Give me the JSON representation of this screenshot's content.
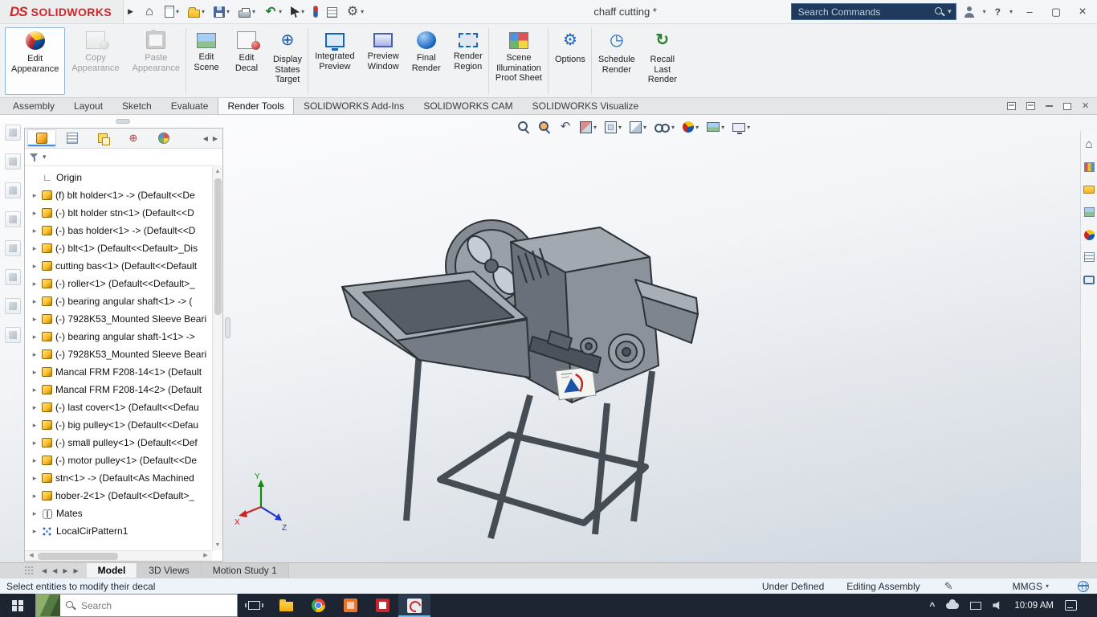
{
  "colors": {
    "brand_red": "#d1242b",
    "accent_blue": "#1565c0",
    "taskbar_bg": "#1c2531",
    "status_bg": "#eef3f9",
    "viewport_bottom": "#cfd6de"
  },
  "titlebar": {
    "logo_ds": "DS",
    "logo_brand": "SOLIDWORKS",
    "doc_title": "chaff cutting *",
    "search_placeholder": "Search Commands",
    "help_label": "?",
    "window": {
      "minimize": "–",
      "maximize": "▢",
      "close": "×"
    },
    "quick_tools": [
      {
        "icon": "home-icon"
      },
      {
        "icon": "new-document-icon",
        "caret": true
      },
      {
        "icon": "open-icon",
        "caret": true
      },
      {
        "icon": "save-icon",
        "caret": true
      },
      {
        "icon": "print-icon",
        "caret": true
      },
      {
        "icon": "undo-icon",
        "caret": true
      },
      {
        "icon": "select-cursor-icon",
        "caret": true
      },
      {
        "icon": "marker-icon"
      },
      {
        "icon": "evaluate-icon"
      },
      {
        "icon": "options-gear-icon",
        "caret": true
      }
    ]
  },
  "ribbon": {
    "buttons": [
      {
        "label": "Edit\nAppearance",
        "icon": "edit-appearance-icon",
        "state": "selected"
      },
      {
        "label": "Copy\nAppearance",
        "icon": "copy-appearance-icon",
        "state": "disabled"
      },
      {
        "label": "Paste\nAppearance",
        "icon": "paste-appearance-icon",
        "state": "disabled gsep"
      },
      {
        "label": "Edit\nScene",
        "icon": "edit-scene-icon"
      },
      {
        "label": "Edit\nDecal",
        "icon": "edit-decal-icon"
      },
      {
        "label": "Display\nStates\nTarget",
        "icon": "display-states-target-icon",
        "glyph": "⊕",
        "state": "gsep"
      },
      {
        "label": "Integrated\nPreview",
        "icon": "integrated-preview-icon"
      },
      {
        "label": "Preview\nWindow",
        "icon": "preview-window-icon"
      },
      {
        "label": "Final\nRender",
        "icon": "final-render-icon"
      },
      {
        "label": "Render\nRegion",
        "icon": "render-region-icon",
        "state": "gsep"
      },
      {
        "label": "Scene\nIllumination\nProof Sheet",
        "icon": "scene-illumination-icon",
        "state": "gsep"
      },
      {
        "label": "Options",
        "icon": "render-options-icon",
        "glyph": "⚙",
        "state": "gsep"
      },
      {
        "label": "Schedule\nRender",
        "icon": "schedule-render-icon",
        "glyph": "◷"
      },
      {
        "label": "Recall\nLast\nRender",
        "icon": "recall-last-render-icon",
        "glyph": "↻"
      }
    ]
  },
  "command_tabs": [
    {
      "label": "Assembly"
    },
    {
      "label": "Layout"
    },
    {
      "label": "Sketch"
    },
    {
      "label": "Evaluate"
    },
    {
      "label": "Render Tools",
      "state": "active"
    },
    {
      "label": "SOLIDWORKS Add-Ins"
    },
    {
      "label": "SOLIDWORKS CAM"
    },
    {
      "label": "SOLIDWORKS Visualize"
    }
  ],
  "fm_panel": {
    "tabs": [
      {
        "icon": "featuremanager-tab-icon",
        "state": "active"
      },
      {
        "icon": "propertymanager-tab-icon"
      },
      {
        "icon": "configurationmanager-tab-icon"
      },
      {
        "icon": "dimxpert-tab-icon",
        "glyph": "⊕"
      },
      {
        "icon": "displaymanager-tab-icon"
      }
    ],
    "tree_items": [
      {
        "icon": "origin-icon",
        "label": "Origin",
        "exp": "noexp"
      },
      {
        "icon": "part-icon",
        "label": "(f) blt holder<1> -> (Default<<De"
      },
      {
        "icon": "part-icon",
        "label": "(-) blt holder stn<1> (Default<<D"
      },
      {
        "icon": "part-icon",
        "label": "(-) bas holder<1> -> (Default<<D"
      },
      {
        "icon": "part-icon",
        "label": "(-) blt<1> (Default<<Default>_Dis"
      },
      {
        "icon": "part-icon",
        "label": "cutting bas<1> (Default<<Default"
      },
      {
        "icon": "part-icon",
        "label": "(-) roller<1> (Default<<Default>_"
      },
      {
        "icon": "part-icon",
        "label": "(-) bearing angular shaft<1> -> ("
      },
      {
        "icon": "part-icon",
        "label": "(-) 7928K53_Mounted Sleeve Beari"
      },
      {
        "icon": "part-icon",
        "label": "(-) bearing angular shaft-1<1> ->"
      },
      {
        "icon": "part-icon",
        "label": "(-) 7928K53_Mounted Sleeve Beari"
      },
      {
        "icon": "part-icon",
        "label": "Mancal FRM F208-14<1> (Default"
      },
      {
        "icon": "part-icon",
        "label": "Mancal FRM F208-14<2> (Default"
      },
      {
        "icon": "part-icon",
        "label": "(-) last cover<1> (Default<<Defau"
      },
      {
        "icon": "part-icon",
        "label": "(-) big pulley<1> (Default<<Defau"
      },
      {
        "icon": "part-icon",
        "label": "(-) small pulley<1> (Default<<Def"
      },
      {
        "icon": "part-icon",
        "label": "(-) motor pulley<1> (Default<<De"
      },
      {
        "icon": "part-icon",
        "label": "stn<1> -> (Default<As Machined"
      },
      {
        "icon": "part-icon",
        "label": "hober-2<1> (Default<<Default>_"
      },
      {
        "icon": "mates-icon",
        "label": "Mates"
      },
      {
        "icon": "pattern-icon",
        "label": "LocalCirPattern1"
      }
    ]
  },
  "hud": {
    "items": [
      {
        "icon": "zoom-fit-icon"
      },
      {
        "icon": "zoom-area-icon"
      },
      {
        "icon": "previous-view-icon"
      },
      {
        "icon": "section-view-icon",
        "caret": true
      },
      {
        "icon": "view-orientation-icon",
        "caret": true
      },
      {
        "icon": "display-style-icon",
        "caret": true
      },
      {
        "icon": "hide-show-items-icon",
        "caret": true
      },
      {
        "icon": "edit-appearance-small-icon",
        "caret": true
      },
      {
        "icon": "apply-scene-icon",
        "caret": true
      },
      {
        "icon": "view-settings-icon",
        "caret": true
      }
    ]
  },
  "task_pane": {
    "icons": [
      {
        "icon": "resources-home-icon"
      },
      {
        "icon": "design-library-icon"
      },
      {
        "icon": "file-explorer-pane-icon"
      },
      {
        "icon": "view-palette-icon"
      },
      {
        "icon": "appearances-icon"
      },
      {
        "icon": "custom-properties-icon"
      },
      {
        "icon": "forum-icon"
      }
    ]
  },
  "viewport": {
    "triad": {
      "x": "X",
      "y": "Y",
      "z": "Z"
    }
  },
  "bottom_tabs": [
    {
      "label": "Model",
      "state": "active"
    },
    {
      "label": "3D Views"
    },
    {
      "label": "Motion Study 1"
    }
  ],
  "statusbar": {
    "message": "Select entities to modify their decal",
    "state": "Under Defined",
    "mode": "Editing Assembly",
    "units": "MMGS"
  },
  "taskbar": {
    "search_placeholder": "Search",
    "time": "10:09 AM"
  }
}
